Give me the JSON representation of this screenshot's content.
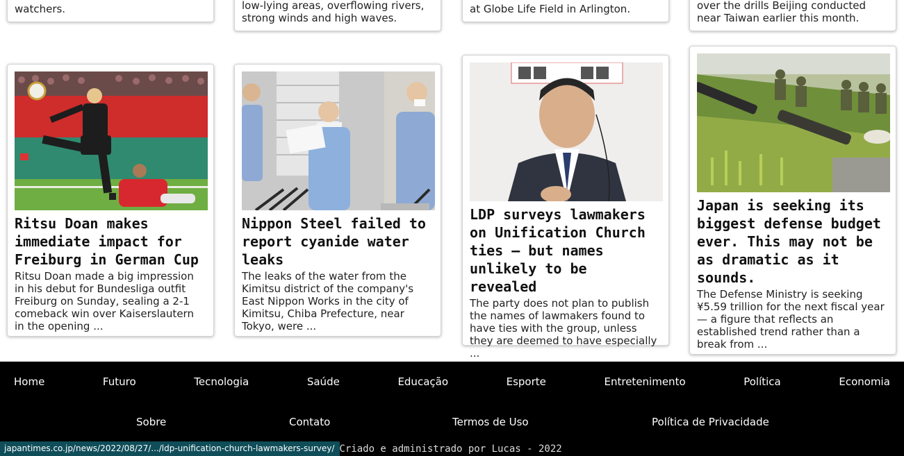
{
  "top_cards": [
    {
      "excerpt": "watchers."
    },
    {
      "excerpt": "low-lying areas, overflowing rivers, strong winds and high waves."
    },
    {
      "excerpt": "at Globe Life Field in Arlington."
    },
    {
      "excerpt": "over the drills Beijing conducted near Taiwan earlier this month."
    }
  ],
  "cards": [
    {
      "headline": "Ritsu Doan makes immediate impact for Freiburg in German Cup",
      "excerpt": "Ritsu Doan made a big impression in his debut for Bundesliga outfit Freiburg on Sunday, sealing a 2-1 comeback win over Kaiserslautern in the opening ..."
    },
    {
      "headline": "Nippon Steel failed to report cyanide water leaks",
      "excerpt": "The leaks of the water from the Kimitsu district of the company's East Nippon Works in the city of Kimitsu, Chiba Prefecture, near Tokyo, were ..."
    },
    {
      "headline": "LDP surveys lawmakers on Unification Church ties — but names unlikely to be revealed",
      "excerpt": "The party does not plan to publish the names of lawmakers found to have ties with the group, unless they are deemed to have especially ..."
    },
    {
      "headline": "Japan is seeking its biggest defense budget ever. This may not be as dramatic as it sounds.",
      "excerpt": "The Defense Ministry is seeking ¥5.59 trillion for the next fiscal year — a figure that reflects an established trend rather than a break from ..."
    }
  ],
  "nav": {
    "row1": [
      "Home",
      "Futuro",
      "Tecnologia",
      "Saúde",
      "Educação",
      "Esporte",
      "Entretenimento",
      "Política",
      "Economia"
    ],
    "row2": [
      "Sobre",
      "Contato",
      "Termos de Uso",
      "Política de Privacidade"
    ]
  },
  "credit": "©Criado e administrado por Lucas - 2022",
  "status_url": "japantimes.co.jp/news/2022/08/27/.../ldp-unification-church-lawmakers-survey/"
}
